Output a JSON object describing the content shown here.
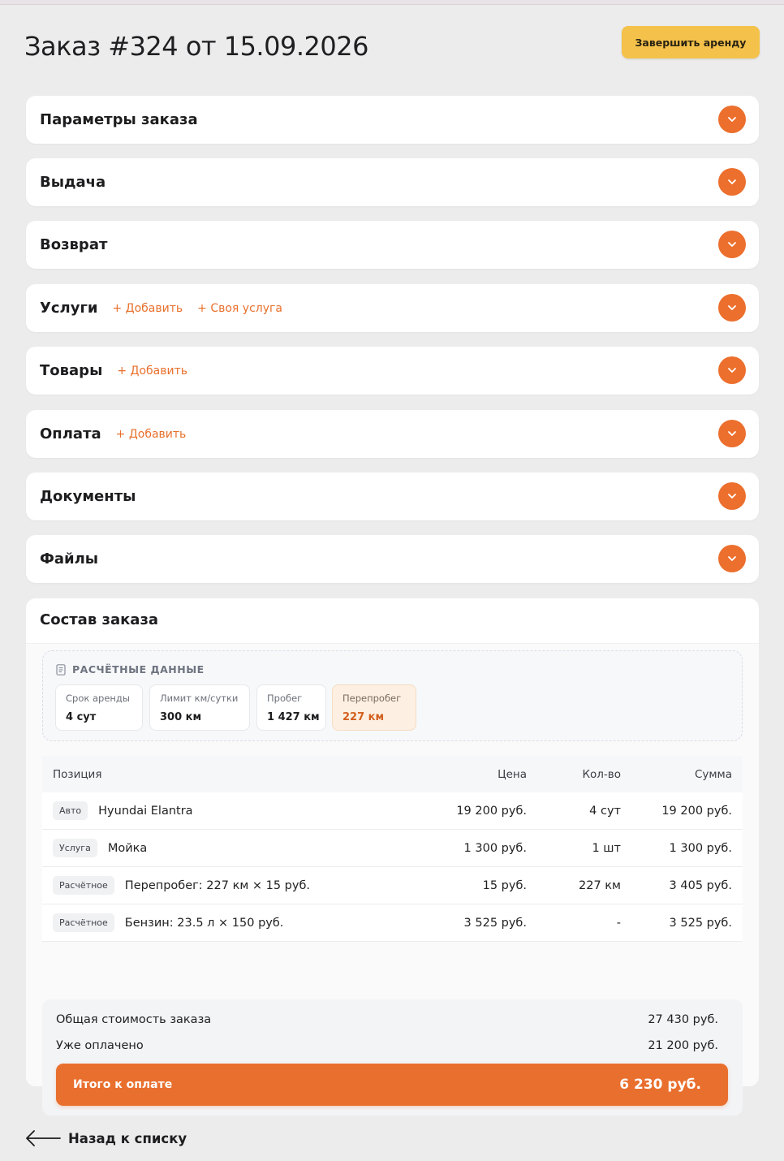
{
  "header": {
    "title": "Заказ #324 от 15.09.2026",
    "finish_label": "Завершить аренду"
  },
  "sections": [
    {
      "title": "Параметры заказа",
      "links": []
    },
    {
      "title": "Выдача",
      "links": []
    },
    {
      "title": "Возврат",
      "links": []
    },
    {
      "title": "Услуги",
      "links": [
        "+ Добавить",
        "+ Своя услуга"
      ]
    },
    {
      "title": "Товары",
      "links": [
        "+ Добавить"
      ]
    },
    {
      "title": "Оплата",
      "links": [
        "+ Добавить"
      ]
    },
    {
      "title": "Документы",
      "links": []
    },
    {
      "title": "Файлы",
      "links": []
    }
  ],
  "order": {
    "title": "Состав заказа",
    "calc": {
      "label": "РАСЧЁТНЫЕ ДАННЫЕ",
      "metrics": [
        {
          "label": "Срок аренды",
          "value": "4 сут"
        },
        {
          "label": "Лимит км/сутки",
          "value": "300 км"
        },
        {
          "label": "Пробег",
          "value": "1 427 км"
        },
        {
          "label": "Перепробег",
          "value": "227 км"
        }
      ]
    },
    "table": {
      "headers": {
        "position": "Позиция",
        "price": "Цена",
        "qty": "Кол-во",
        "sum": "Сумма"
      },
      "rows": [
        {
          "tag": "Авто",
          "name": "Hyundai Elantra",
          "price": "19 200 руб.",
          "qty": "4 сут",
          "sum": "19 200 руб."
        },
        {
          "tag": "Услуга",
          "name": "Мойка",
          "price": "1 300 руб.",
          "qty": "1 шт",
          "sum": "1 300 руб."
        },
        {
          "tag": "Расчётное",
          "name": "Перепробег: 227 км × 15 руб.",
          "price": "15 руб.",
          "qty": "227 км",
          "sum": "3 405 руб."
        },
        {
          "tag": "Расчётное",
          "name": "Бензин: 23.5 л × 150 руб.",
          "price": "3 525 руб.",
          "qty": "-",
          "sum": "3 525 руб."
        }
      ]
    },
    "totals": {
      "total_label": "Общая стоимость заказа",
      "total_value": "27 430 руб.",
      "paid_label": "Уже оплачено",
      "paid_value": "21 200 руб.",
      "due_label": "Итого к оплате",
      "due_value": "6 230 руб."
    }
  },
  "back_label": "Назад к списку",
  "colors": {
    "accent": "#ec6f2d",
    "button": "#f4c24a",
    "background": "#ececec"
  }
}
